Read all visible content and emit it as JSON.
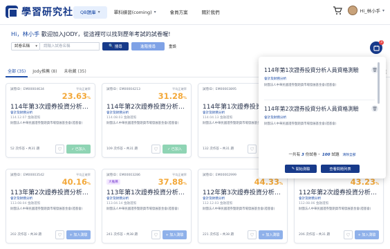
{
  "header": {
    "logo_text": "學習研究社",
    "nav": [
      {
        "label": "QB題庫",
        "dropdown": true,
        "active": true
      },
      {
        "label": "單科練習(coming)",
        "dropdown": true,
        "active": false
      },
      {
        "label": "會員方案",
        "dropdown": false,
        "active": false
      },
      {
        "label": "關於我們",
        "dropdown": false,
        "active": false
      }
    ],
    "user_name": "Hi_林小手"
  },
  "welcome": {
    "greeting": "Hi，林小手",
    "message": "歡迎加入JODY，從這裡可以找到歷年考試的試卷喔!"
  },
  "search": {
    "select_value": "試卷名稱",
    "input_placeholder": "請輸入試卷名稱",
    "search_label": "搜尋",
    "advanced_label": "進階搜尋",
    "reset_label": "重設"
  },
  "tabs": [
    "全部 (35)",
    "Jody推薦 (8)",
    "未收藏 (35)"
  ],
  "cards": [
    {
      "id": "試卷ID：EM00004634",
      "avg_label": "平均正確率",
      "avg": "23.63",
      "tag": "",
      "title": "114年第3次證券投資分析人員資格測驗",
      "subject": "會計及財務分析",
      "date": "114.12.07 金融證照",
      "org": "財團法人中華民國證券暨期貨市場發展基金會(證基會)",
      "stats": "52 次作答・共31 題",
      "action": "已加入",
      "added": true
    },
    {
      "id": "試卷ID：EM00004213",
      "avg_label": "平均正確率",
      "avg": "31.28",
      "tag": "",
      "title": "114年第2次證券投資分析人員資格測驗",
      "subject": "會計及財務分析",
      "date": "114.08.03 金融證照",
      "org": "財團法人中華民國證券暨期貨市場發展基金會(證基會)",
      "stats": "109 次作答・共31 題",
      "action": "已加入",
      "added": true
    },
    {
      "id": "試卷ID：EM00003895",
      "avg_label": "平均正確率",
      "avg": "",
      "tag": "",
      "title": "114年第1次證券投資分析人員資格測驗",
      "subject": "會計及財務分析",
      "date": "114.04.13 金融證照",
      "org": "財團法人中華民國證券暨期貨市場發展基金會(證基會)",
      "stats": "132 次作答・共31 題",
      "action": "",
      "added": true
    },
    {
      "id": "試卷ID：EM00003542",
      "avg_label": "平均正確率",
      "avg": "40.16",
      "tag": "",
      "title": "113年第2次證券投資分析人員資格測驗",
      "subject": "會計及財務分析",
      "date": "113.08.04 金融證照",
      "org": "財團法人中華民國證券暨期貨市場發展基金會(證基會)",
      "stats": "202 次作答・共38 題",
      "action": "+ 加入測驗",
      "added": false
    },
    {
      "id": "試卷ID：EM00003286",
      "avg_label": "平均正確率",
      "avg": "37.88",
      "tag": "大推薦",
      "title": "113年第1次證券投資分析人員資格測驗",
      "subject": "會計及財務分析",
      "date": "113.04.14 金融證照",
      "org": "財團法人中華民國證券暨期貨市場發展基金會(證基會)",
      "stats": "241 次作答・共38 題",
      "action": "+ 加入測驗",
      "added": false
    },
    {
      "id": "試卷ID：EM00002999",
      "avg_label": "平均正確率",
      "avg": "44.33",
      "tag": "",
      "title": "112年第3次證券投資分析人員資格測驗",
      "subject": "會計及財務分析",
      "date": "112.12.03 金融證照",
      "org": "財團法人中華民國證券暨期貨市場發展基金會(證基會)",
      "stats": "221 次作答・共38 題",
      "action": "+ 加入測驗",
      "added": false
    },
    {
      "id": "試卷ID：",
      "avg_label": "平均正確率",
      "avg": "43.23",
      "tag": "",
      "title": "112年第2次證券投資分析人員資格測驗",
      "subject": "會計及財務分析",
      "date": "112.08.06 金融證照",
      "org": "財團法人中華民國證券暨期貨市場發展基金會(證基會)",
      "stats": "206 次作答・共31 題",
      "action": "+ 加入測驗",
      "added": false
    }
  ],
  "popup": {
    "items": [
      {
        "title": "114年第1次證券投資分析人員資格測驗",
        "subject": "會計及財務分析",
        "org": "財團法人中華民國證券暨期貨市場發展基金會(證基會)"
      },
      {
        "title": "114年第2次證券投資分析人員資格測驗",
        "subject": "會計及財務分析",
        "org": "財團法人中華民國證券暨期貨市場發展基金會(證基會)"
      }
    ],
    "summary_prefix": "一共有",
    "summary_count": "3",
    "summary_mid": "份試卷・",
    "summary_questions": "100",
    "summary_suffix": "試題",
    "clear_label": "清除全部",
    "start_label": "開始測驗",
    "list_label": "查看問題列表"
  },
  "fab_badge": "3",
  "colors": {
    "brand": "#173a8a",
    "accent": "#f3a93b",
    "added": "#8fd4b4",
    "add": "#8fb1ea"
  }
}
